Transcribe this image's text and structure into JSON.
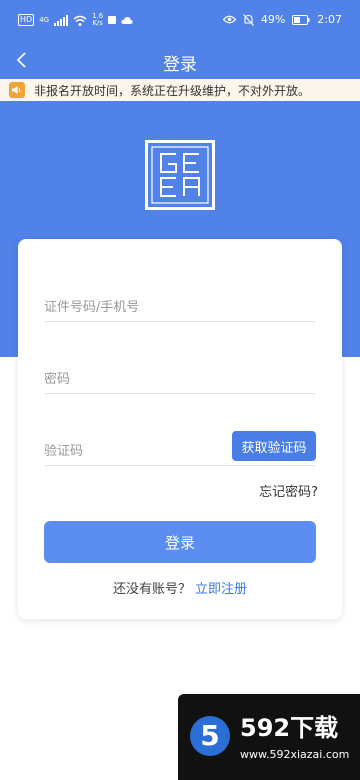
{
  "status_bar": {
    "network_gen": "4G",
    "speed_value": "1.6",
    "speed_unit": "K/s",
    "battery": "49%",
    "time": "2:07"
  },
  "nav": {
    "title": "登录"
  },
  "notice": {
    "text": "非报名开放时间，系统正在升级维护，不对外开放。"
  },
  "logo": {
    "text": "GEEA"
  },
  "form": {
    "id_placeholder": "证件号码/手机号",
    "password_placeholder": "密码",
    "code_placeholder": "验证码",
    "get_code_label": "获取验证码",
    "forgot_label": "忘记密码?",
    "login_label": "登录",
    "register_prompt": "还没有账号？",
    "register_link": "立即注册"
  },
  "watermark": {
    "badge": "5",
    "brand": "592下载",
    "url": "www.592xiazai.com"
  },
  "colors": {
    "primary_blue": "#5182e8",
    "button_blue": "#5b8ef0",
    "link_blue": "#3f78e0",
    "notice_bg": "#fdf6ec",
    "notice_icon": "#f2a33a"
  }
}
